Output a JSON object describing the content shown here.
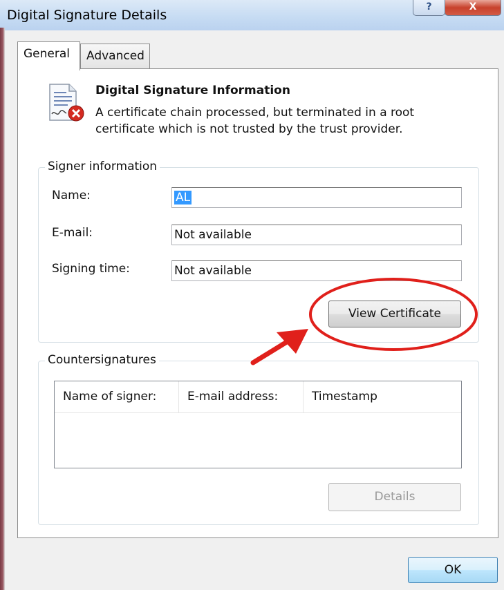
{
  "window": {
    "title": "Digital Signature Details",
    "help_label": "?",
    "close_label": "X"
  },
  "tabs": [
    {
      "label": "General",
      "selected": true
    },
    {
      "label": "Advanced",
      "selected": false
    }
  ],
  "header": {
    "title": "Digital Signature Information",
    "message_line1": "A certificate chain processed, but terminated in a root",
    "message_line2": "certificate which is not trusted by the trust provider."
  },
  "signer": {
    "legend": "Signer information",
    "name_label": "Name:",
    "name_value": "AL",
    "email_label": "E-mail:",
    "email_value": "Not available",
    "time_label": "Signing time:",
    "time_value": "Not available",
    "view_certificate_label": "View Certificate"
  },
  "countersignatures": {
    "legend": "Countersignatures",
    "columns": [
      "Name of signer:",
      "E-mail address:",
      "Timestamp"
    ],
    "details_label": "Details"
  },
  "footer": {
    "ok_label": "OK"
  },
  "colors": {
    "annotation_red": "#e0201b",
    "selection_blue": "#3399ff"
  },
  "icons": [
    "signed-document-error-icon"
  ]
}
